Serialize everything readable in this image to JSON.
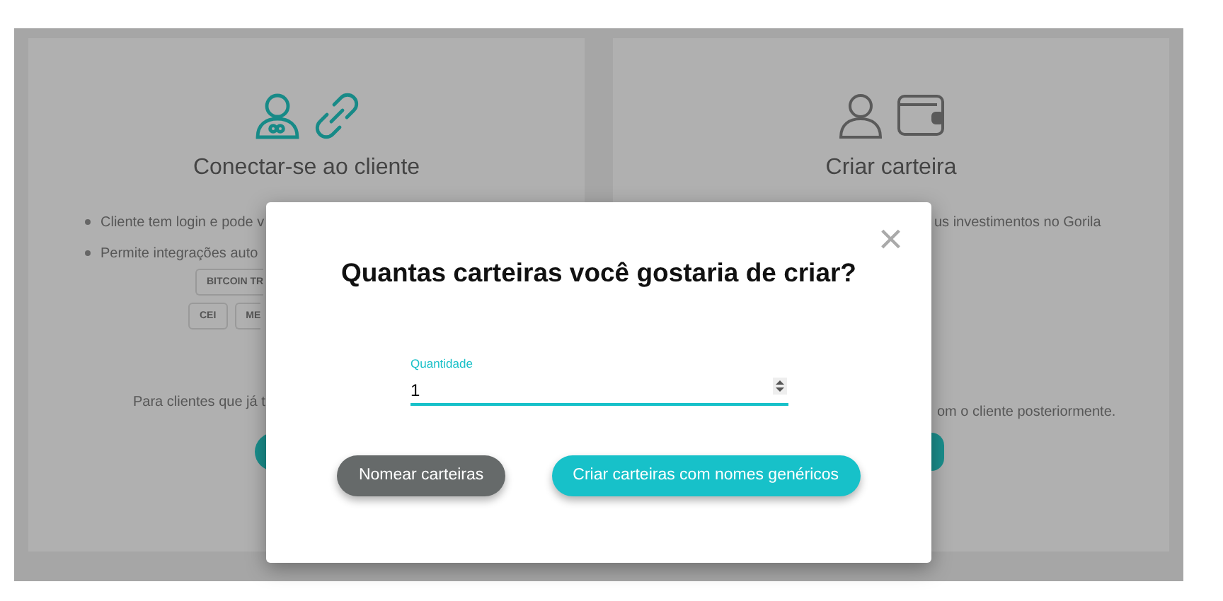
{
  "background_cards": [
    {
      "kind": "connect",
      "title": "Conectar-se ao cliente",
      "bullets": [
        "Cliente tem login e pode v",
        "Permite integrações auto"
      ],
      "chip_rows": [
        [
          "BITCOIN TR"
        ],
        [
          "CEI",
          "ME"
        ]
      ],
      "note": "Para clientes que já t"
    },
    {
      "kind": "create",
      "title": "Criar carteira",
      "lines": [
        "us investimentos no Gorila",
        "om o cliente posteriormente."
      ]
    }
  ],
  "modal": {
    "title": "Quantas carteiras você gostaria de criar?",
    "close": "×",
    "field": {
      "label": "Quantidade",
      "value": "1"
    },
    "buttons": [
      {
        "label": "Nomear carteiras",
        "kind": "secondary"
      },
      {
        "label": "Criar carteiras com nomes genéricos",
        "kind": "primary"
      }
    ]
  }
}
